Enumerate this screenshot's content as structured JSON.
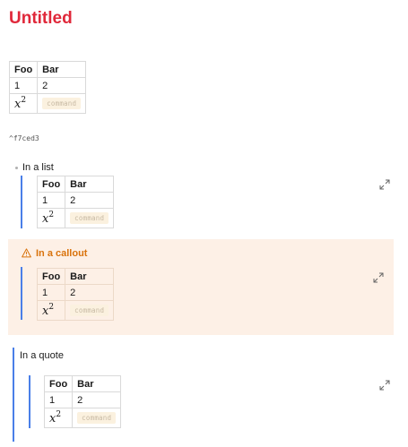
{
  "page": {
    "title": "Untitled",
    "block_id": "^f7ced3"
  },
  "table": {
    "headers": [
      "Foo",
      "Bar"
    ],
    "row1": [
      "1",
      "2"
    ],
    "math_base": "x",
    "math_exp": "2",
    "command_label": "command"
  },
  "list": {
    "text": "In a list"
  },
  "callout": {
    "title": "In a callout",
    "icon": "warning-icon",
    "color": "#d9730d"
  },
  "quote": {
    "text": "In a quote"
  },
  "icons": {
    "expand": "expand-icon"
  },
  "colors": {
    "title": "#e0283a",
    "accent_bar": "#4a7fe8",
    "callout_bg": "#fdf0e6"
  }
}
